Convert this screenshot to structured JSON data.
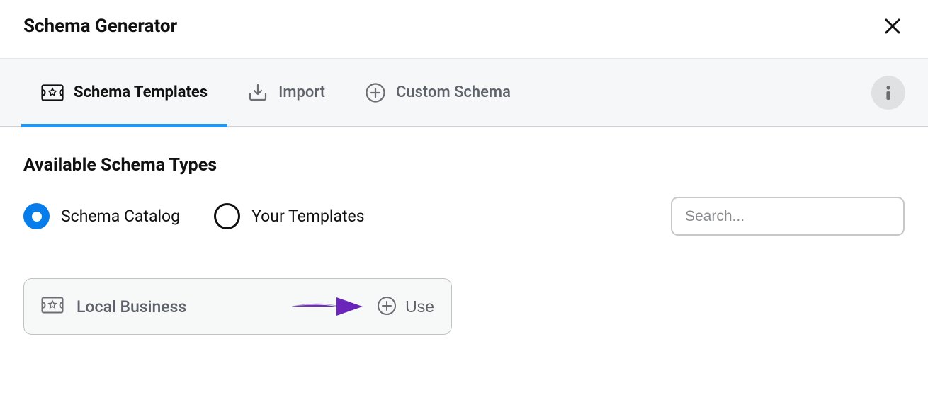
{
  "header": {
    "title": "Schema Generator"
  },
  "tabs": [
    {
      "label": "Schema Templates",
      "active": true
    },
    {
      "label": "Import",
      "active": false
    },
    {
      "label": "Custom Schema",
      "active": false
    }
  ],
  "section": {
    "title": "Available Schema Types"
  },
  "radios": {
    "catalog": "Schema Catalog",
    "templates": "Your Templates"
  },
  "search": {
    "placeholder": "Search..."
  },
  "card": {
    "title": "Local Business",
    "use_label": "Use"
  }
}
